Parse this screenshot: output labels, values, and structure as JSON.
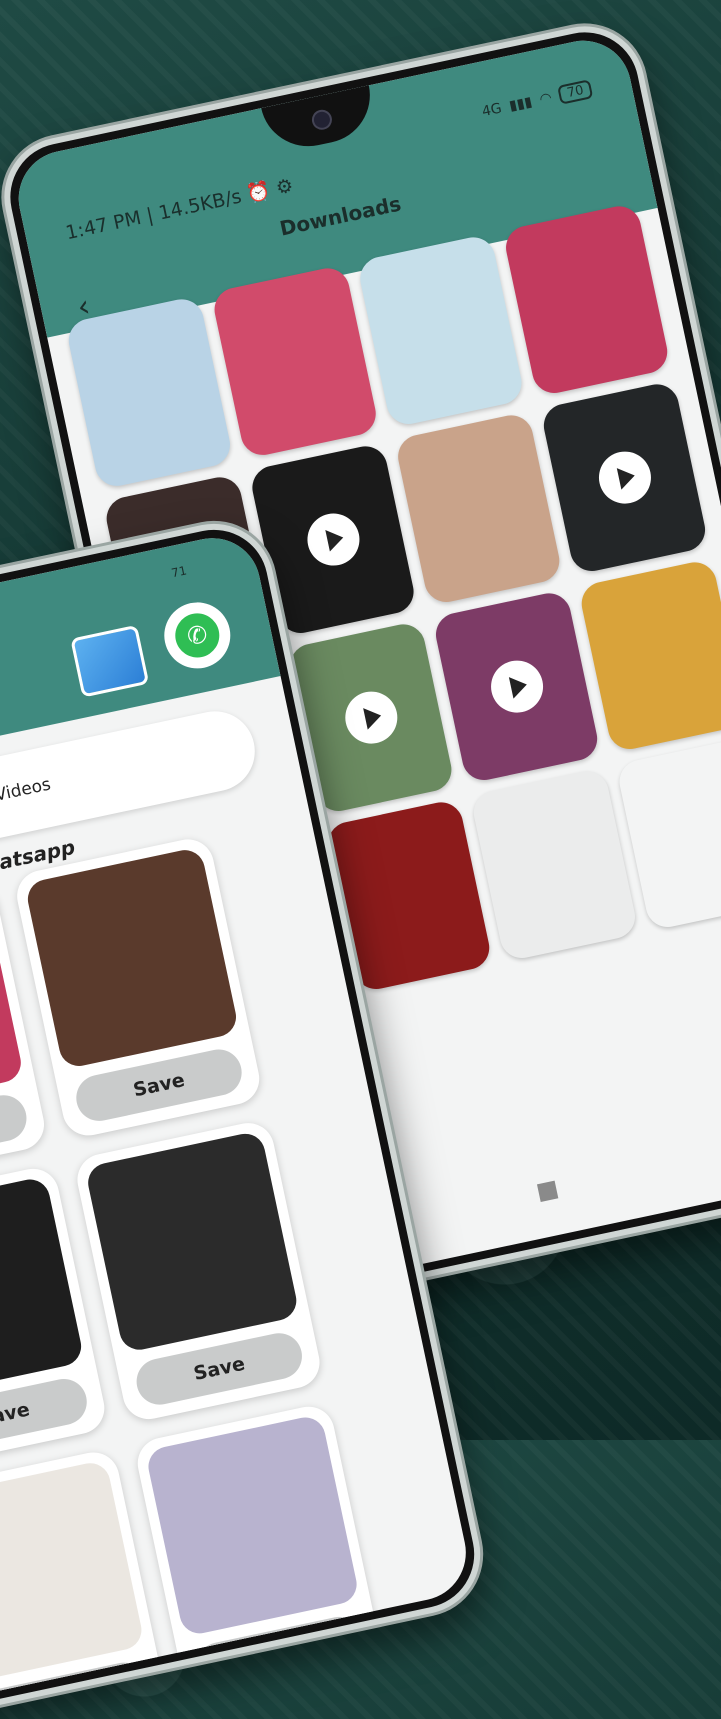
{
  "right_phone": {
    "status_text": "1:47 PM | 14.5KB/s",
    "network": "4G",
    "battery": "70",
    "title": "Downloads",
    "back_icon": "back-arrow-icon",
    "tiles": [
      {
        "kind": "image",
        "color": "#b9d3e6"
      },
      {
        "kind": "image",
        "color": "#d14b6b"
      },
      {
        "kind": "image",
        "color": "#c6dfea"
      },
      {
        "kind": "image",
        "color": "#c23a5e"
      },
      {
        "kind": "image",
        "color": "#3b2c2a"
      },
      {
        "kind": "video",
        "color": "#1a1a1a"
      },
      {
        "kind": "image",
        "color": "#c9a38a"
      },
      {
        "kind": "video",
        "color": "#232628"
      },
      {
        "kind": "image",
        "color": "#2a2a2a"
      },
      {
        "kind": "video",
        "color": "#6a8a60"
      },
      {
        "kind": "video",
        "color": "#7d3b66"
      },
      {
        "kind": "image",
        "color": "#d9a33a"
      },
      {
        "kind": "image",
        "color": "#2b2b2b"
      },
      {
        "kind": "image",
        "color": "#8c1b1b"
      },
      {
        "kind": "image",
        "color": "#ebecec"
      },
      {
        "kind": "image",
        "color": "#f3f4f4"
      }
    ]
  },
  "left_phone": {
    "battery": "71",
    "videos_label": "Videos",
    "path_label": "ver/Whatsapp",
    "save_label": "Save",
    "cards": [
      {
        "color": "#c23a5e"
      },
      {
        "color": "#5a3a2c"
      },
      {
        "color": "#1e1e1e"
      },
      {
        "color": "#2b2b2b"
      },
      {
        "color": "#ebe7e1"
      },
      {
        "color": "#b8b3cf"
      }
    ]
  }
}
